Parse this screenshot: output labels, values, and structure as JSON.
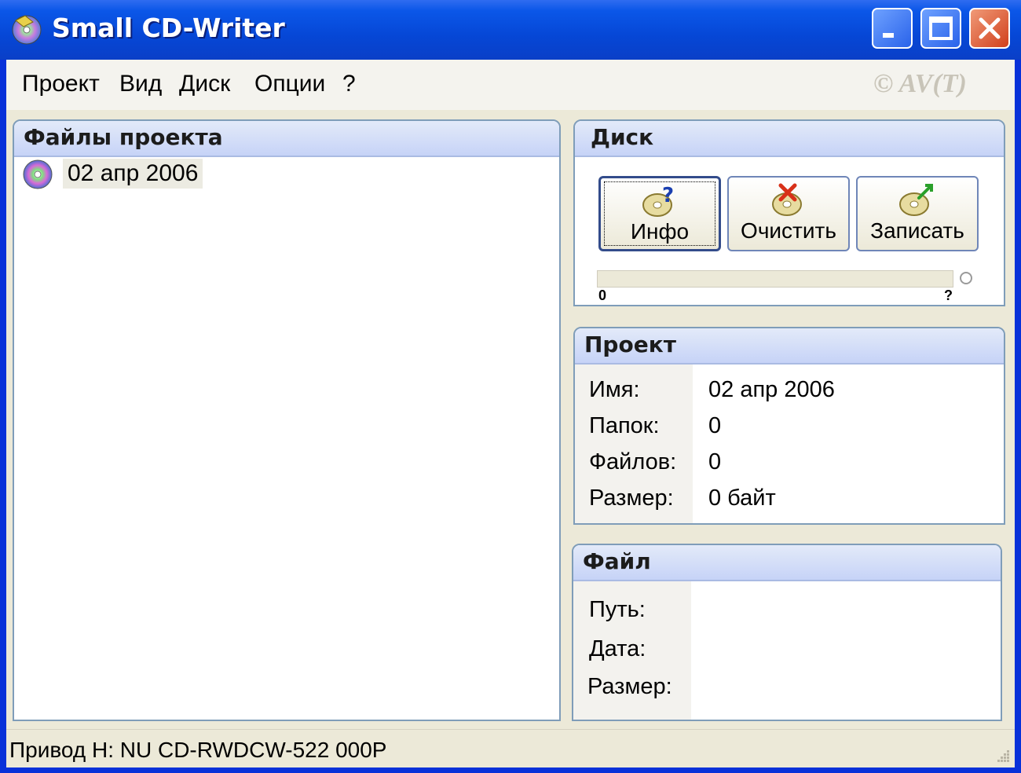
{
  "window": {
    "title": "Small CD-Writer"
  },
  "menu": {
    "items": [
      "Проект",
      "Вид",
      "Диск",
      "Опции",
      "?"
    ],
    "copyright": "© AV(T)"
  },
  "files_panel": {
    "title": "Файлы проекта",
    "items": [
      {
        "label": "02 апр 2006",
        "icon": "cd-icon"
      }
    ]
  },
  "disk_panel": {
    "title": "Диск",
    "buttons": {
      "info": "Инфо",
      "clear": "Очистить",
      "write": "Записать"
    },
    "progress": {
      "min_label": "0",
      "max_label": "?",
      "value": 0
    }
  },
  "project_panel": {
    "title": "Проект",
    "labels": {
      "name": "Имя:",
      "folders": "Папок:",
      "files": "Файлов:",
      "size": "Размер:"
    },
    "values": {
      "name": "02 апр 2006",
      "folders": "0",
      "files": "0",
      "size": "0 байт"
    }
  },
  "file_panel": {
    "title": "Файл",
    "labels": {
      "path": "Путь:",
      "date": "Дата:",
      "size": "Размер:"
    }
  },
  "status": {
    "text": "Привод  H: NU CD-RWDCW-522 000P"
  }
}
